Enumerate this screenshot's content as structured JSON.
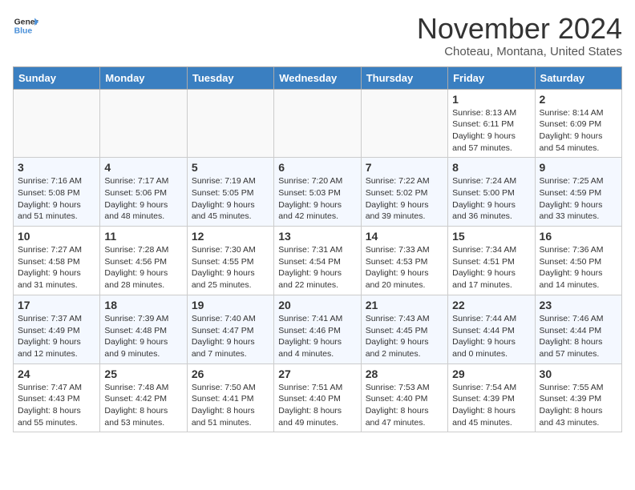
{
  "header": {
    "logo_line1": "General",
    "logo_line2": "Blue",
    "month_title": "November 2024",
    "location": "Choteau, Montana, United States"
  },
  "weekdays": [
    "Sunday",
    "Monday",
    "Tuesday",
    "Wednesday",
    "Thursday",
    "Friday",
    "Saturday"
  ],
  "weeks": [
    [
      {
        "day": "",
        "info": ""
      },
      {
        "day": "",
        "info": ""
      },
      {
        "day": "",
        "info": ""
      },
      {
        "day": "",
        "info": ""
      },
      {
        "day": "",
        "info": ""
      },
      {
        "day": "1",
        "info": "Sunrise: 8:13 AM\nSunset: 6:11 PM\nDaylight: 9 hours and 57 minutes."
      },
      {
        "day": "2",
        "info": "Sunrise: 8:14 AM\nSunset: 6:09 PM\nDaylight: 9 hours and 54 minutes."
      }
    ],
    [
      {
        "day": "3",
        "info": "Sunrise: 7:16 AM\nSunset: 5:08 PM\nDaylight: 9 hours and 51 minutes."
      },
      {
        "day": "4",
        "info": "Sunrise: 7:17 AM\nSunset: 5:06 PM\nDaylight: 9 hours and 48 minutes."
      },
      {
        "day": "5",
        "info": "Sunrise: 7:19 AM\nSunset: 5:05 PM\nDaylight: 9 hours and 45 minutes."
      },
      {
        "day": "6",
        "info": "Sunrise: 7:20 AM\nSunset: 5:03 PM\nDaylight: 9 hours and 42 minutes."
      },
      {
        "day": "7",
        "info": "Sunrise: 7:22 AM\nSunset: 5:02 PM\nDaylight: 9 hours and 39 minutes."
      },
      {
        "day": "8",
        "info": "Sunrise: 7:24 AM\nSunset: 5:00 PM\nDaylight: 9 hours and 36 minutes."
      },
      {
        "day": "9",
        "info": "Sunrise: 7:25 AM\nSunset: 4:59 PM\nDaylight: 9 hours and 33 minutes."
      }
    ],
    [
      {
        "day": "10",
        "info": "Sunrise: 7:27 AM\nSunset: 4:58 PM\nDaylight: 9 hours and 31 minutes."
      },
      {
        "day": "11",
        "info": "Sunrise: 7:28 AM\nSunset: 4:56 PM\nDaylight: 9 hours and 28 minutes."
      },
      {
        "day": "12",
        "info": "Sunrise: 7:30 AM\nSunset: 4:55 PM\nDaylight: 9 hours and 25 minutes."
      },
      {
        "day": "13",
        "info": "Sunrise: 7:31 AM\nSunset: 4:54 PM\nDaylight: 9 hours and 22 minutes."
      },
      {
        "day": "14",
        "info": "Sunrise: 7:33 AM\nSunset: 4:53 PM\nDaylight: 9 hours and 20 minutes."
      },
      {
        "day": "15",
        "info": "Sunrise: 7:34 AM\nSunset: 4:51 PM\nDaylight: 9 hours and 17 minutes."
      },
      {
        "day": "16",
        "info": "Sunrise: 7:36 AM\nSunset: 4:50 PM\nDaylight: 9 hours and 14 minutes."
      }
    ],
    [
      {
        "day": "17",
        "info": "Sunrise: 7:37 AM\nSunset: 4:49 PM\nDaylight: 9 hours and 12 minutes."
      },
      {
        "day": "18",
        "info": "Sunrise: 7:39 AM\nSunset: 4:48 PM\nDaylight: 9 hours and 9 minutes."
      },
      {
        "day": "19",
        "info": "Sunrise: 7:40 AM\nSunset: 4:47 PM\nDaylight: 9 hours and 7 minutes."
      },
      {
        "day": "20",
        "info": "Sunrise: 7:41 AM\nSunset: 4:46 PM\nDaylight: 9 hours and 4 minutes."
      },
      {
        "day": "21",
        "info": "Sunrise: 7:43 AM\nSunset: 4:45 PM\nDaylight: 9 hours and 2 minutes."
      },
      {
        "day": "22",
        "info": "Sunrise: 7:44 AM\nSunset: 4:44 PM\nDaylight: 9 hours and 0 minutes."
      },
      {
        "day": "23",
        "info": "Sunrise: 7:46 AM\nSunset: 4:44 PM\nDaylight: 8 hours and 57 minutes."
      }
    ],
    [
      {
        "day": "24",
        "info": "Sunrise: 7:47 AM\nSunset: 4:43 PM\nDaylight: 8 hours and 55 minutes."
      },
      {
        "day": "25",
        "info": "Sunrise: 7:48 AM\nSunset: 4:42 PM\nDaylight: 8 hours and 53 minutes."
      },
      {
        "day": "26",
        "info": "Sunrise: 7:50 AM\nSunset: 4:41 PM\nDaylight: 8 hours and 51 minutes."
      },
      {
        "day": "27",
        "info": "Sunrise: 7:51 AM\nSunset: 4:40 PM\nDaylight: 8 hours and 49 minutes."
      },
      {
        "day": "28",
        "info": "Sunrise: 7:53 AM\nSunset: 4:40 PM\nDaylight: 8 hours and 47 minutes."
      },
      {
        "day": "29",
        "info": "Sunrise: 7:54 AM\nSunset: 4:39 PM\nDaylight: 8 hours and 45 minutes."
      },
      {
        "day": "30",
        "info": "Sunrise: 7:55 AM\nSunset: 4:39 PM\nDaylight: 8 hours and 43 minutes."
      }
    ]
  ]
}
